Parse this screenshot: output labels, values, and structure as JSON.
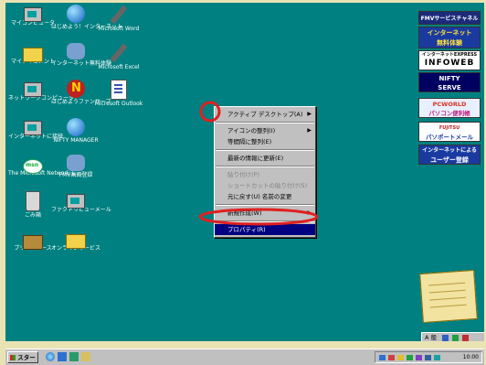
{
  "desktop_icons": [
    {
      "label": "マイコンピュータ",
      "icon": "my-computer-icon"
    },
    {
      "label": "はじめよう！インターネット",
      "icon": "internet-globe-icon"
    },
    {
      "label": "Microsoft Word",
      "icon": "word-icon"
    },
    {
      "label": "マイドキュメント",
      "icon": "my-documents-icon"
    },
    {
      "label": "インターネット無料体験",
      "icon": "internet-trial-icon"
    },
    {
      "label": "Microsoft Excel",
      "icon": "excel-icon"
    },
    {
      "label": "ネットワークコンピュータ",
      "icon": "network-computers-icon"
    },
    {
      "label": "はじめようファンサーブ",
      "icon": "funserve-icon"
    },
    {
      "label": "Microsoft Outlook",
      "icon": "outlook-icon"
    },
    {
      "label": "インターネットに接続",
      "icon": "connect-internet-icon"
    },
    {
      "label": "NIFTY MANAGER",
      "icon": "nifty-manager-icon"
    },
    {
      "label": "The Microsoft Network に…",
      "icon": "msn-icon"
    },
    {
      "label": "FMV画面登録",
      "icon": "fmv-register-icon"
    },
    {
      "label": "ごみ箱",
      "icon": "recycle-bin-icon"
    },
    {
      "label": "ファクトリビューメール",
      "icon": "mail-icon"
    },
    {
      "label": "ブリーフケース",
      "icon": "briefcase-icon"
    },
    {
      "label": "オンラインサービス",
      "icon": "online-services-icon"
    }
  ],
  "context_menu": {
    "items": [
      {
        "label": "アクティブ デスクトップ(A)",
        "submenu": true,
        "disabled": false,
        "selected": false
      },
      {
        "label": "アイコンの整列(I)",
        "submenu": true,
        "disabled": false,
        "selected": false
      },
      {
        "label": "等間隔に整列(E)",
        "submenu": false,
        "disabled": false,
        "selected": false
      },
      {
        "label": "最新の情報に更新(E)",
        "submenu": false,
        "disabled": false,
        "selected": false
      },
      {
        "label": "貼り付け(P)",
        "submenu": false,
        "disabled": true,
        "selected": false
      },
      {
        "label": "ショートカットの貼り付け(S)",
        "submenu": false,
        "disabled": true,
        "selected": false
      },
      {
        "label": "元に戻す(U) 名前の変更",
        "submenu": false,
        "disabled": false,
        "selected": false
      },
      {
        "label": "新規作成(W)",
        "submenu": true,
        "disabled": false,
        "selected": false
      },
      {
        "label": "プロパティ(R)",
        "submenu": false,
        "disabled": false,
        "selected": true
      }
    ]
  },
  "banners": [
    {
      "line1": "FMVサービスチャネル",
      "line2": "",
      "colors": {
        "bg": "#1b2a7a",
        "fg": "#ffffff"
      }
    },
    {
      "line1": "インターネット",
      "line2": "無料体験",
      "colors": {
        "bg": "#1a3aa0",
        "fg": "#ffe040"
      }
    },
    {
      "line1": "インターネットEXPRESS",
      "line2": "INFOWEB",
      "colors": {
        "bg": "#ffffff",
        "fg": "#000000"
      }
    },
    {
      "line1": "NIFTY",
      "line2": "SERVE",
      "colors": {
        "bg": "#000060",
        "fg": "#ffffff"
      }
    },
    {
      "line1": "PCWORLD",
      "line2": "パソコン便利帳",
      "colors": {
        "bg": "#e8f0ff",
        "fg": "#c02080"
      }
    },
    {
      "line1": "FUJITSU",
      "line2": "パソポートメール",
      "colors": {
        "bg": "#ffffff",
        "fg": "#1a3aa0"
      }
    },
    {
      "line1": "インターネットによる",
      "line2": "ユーザー登録",
      "colors": {
        "bg": "#1a3aa0",
        "fg": "#ffffff"
      }
    }
  ],
  "taskbar": {
    "start_label": "スタート",
    "clock": "10:00",
    "language_bar": "A 般"
  },
  "colors": {
    "desktop": "#008080",
    "frame": "#e9e3b3",
    "highlight_ring": "#e02020",
    "selection": "#000080"
  }
}
